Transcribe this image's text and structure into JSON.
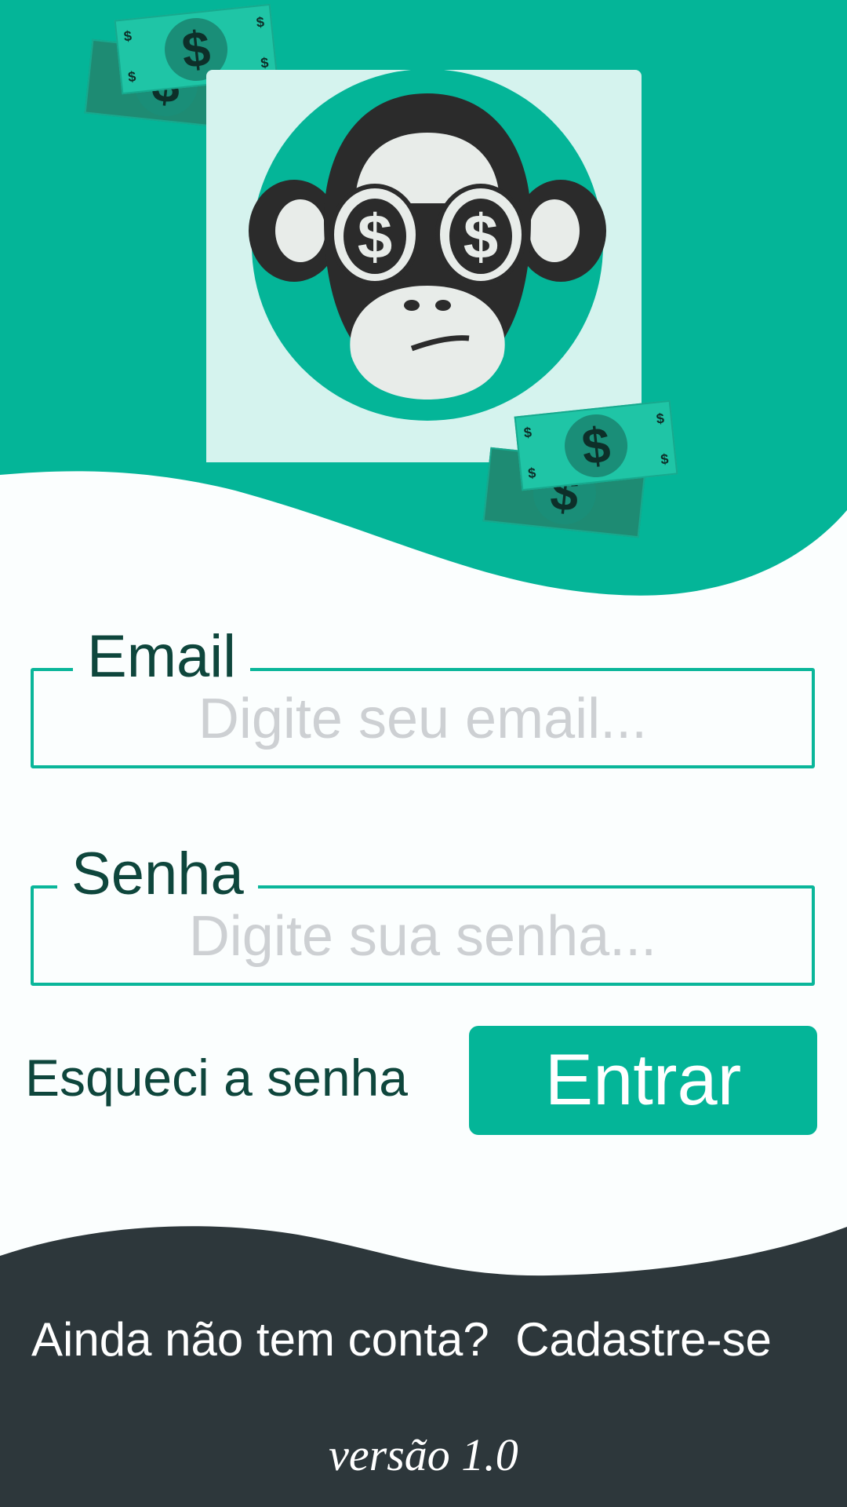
{
  "colors": {
    "brand": "#04b598",
    "dark": "#2d373b",
    "label": "#0e463c",
    "placeholder": "#cdd0d3",
    "card": "#d5f3ee"
  },
  "logo": {
    "name": "monkey-money-logo",
    "bill_symbol": "$"
  },
  "form": {
    "email": {
      "label": "Email",
      "placeholder": "Digite seu email..."
    },
    "password": {
      "label": "Senha",
      "placeholder": "Digite sua senha..."
    },
    "forgot_label": "Esqueci a senha",
    "submit_label": "Entrar"
  },
  "footer": {
    "question": "Ainda não tem conta?",
    "signup_label": "Cadastre-se",
    "version": "versão 1.0"
  }
}
